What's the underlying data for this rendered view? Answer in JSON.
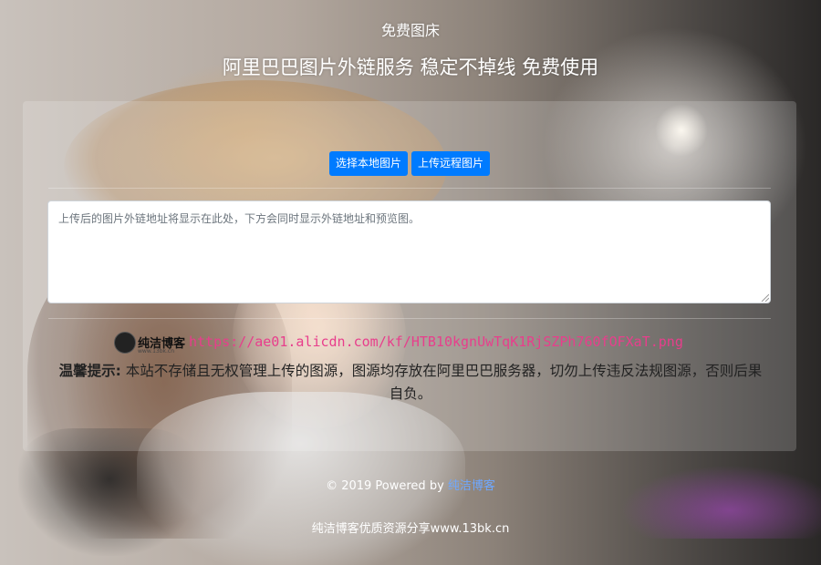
{
  "header": {
    "site_title": "免费图床",
    "tagline": "阿里巴巴图片外链服务 稳定不掉线 免费使用"
  },
  "upload": {
    "local_button_label": "选择本地图片",
    "remote_button_label": "上传远程图片",
    "result_placeholder": "上传后的图片外链地址将显示在此处，下方会同时显示外链地址和预览图。"
  },
  "preview": {
    "logo_text": "纯洁博客",
    "logo_subtext": "www.13bk.cn",
    "image_url": "https://ae01.alicdn.com/kf/HTB10kgnUwTqK1RjSZPh760fOFXaT.png"
  },
  "notice": {
    "label": "温馨提示:",
    "text": " 本站不存储且无权管理上传的图源，图源均存放在阿里巴巴服务器，切勿上传违反法规图源，否则后果自负。"
  },
  "footer": {
    "copyright_prefix": "© 2019 Powered by",
    "blog_link_label": "纯洁博客",
    "tagline": "纯洁博客优质资源分享www.13bk.cn"
  },
  "colors": {
    "primary_button": "#007bff",
    "url_text": "#e83e8c",
    "footer_link": "#6fa8ff"
  }
}
